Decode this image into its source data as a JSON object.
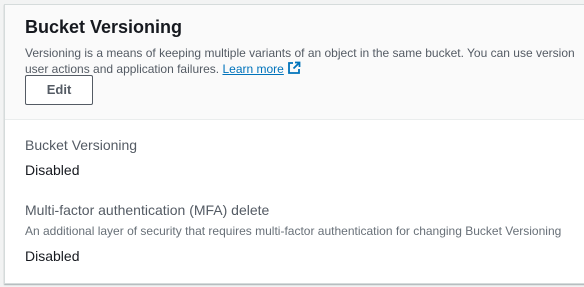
{
  "section": {
    "title": "Bucket Versioning",
    "description_line1": "Versioning is a means of keeping multiple variants of an object in the same bucket. You can use version",
    "description_line2": "user actions and application failures.",
    "learn_more": "Learn more",
    "edit_label": "Edit"
  },
  "fields": {
    "versioning": {
      "label": "Bucket Versioning",
      "value": "Disabled"
    },
    "mfa_delete": {
      "label": "Multi-factor authentication (MFA) delete",
      "description": "An additional layer of security that requires multi-factor authentication for changing Bucket Versioning",
      "value": "Disabled"
    }
  },
  "colors": {
    "link": "#0073bb",
    "text": "#16191f",
    "secondary_text": "#545b64"
  },
  "icons": {
    "learn_more": "external-link-icon"
  }
}
